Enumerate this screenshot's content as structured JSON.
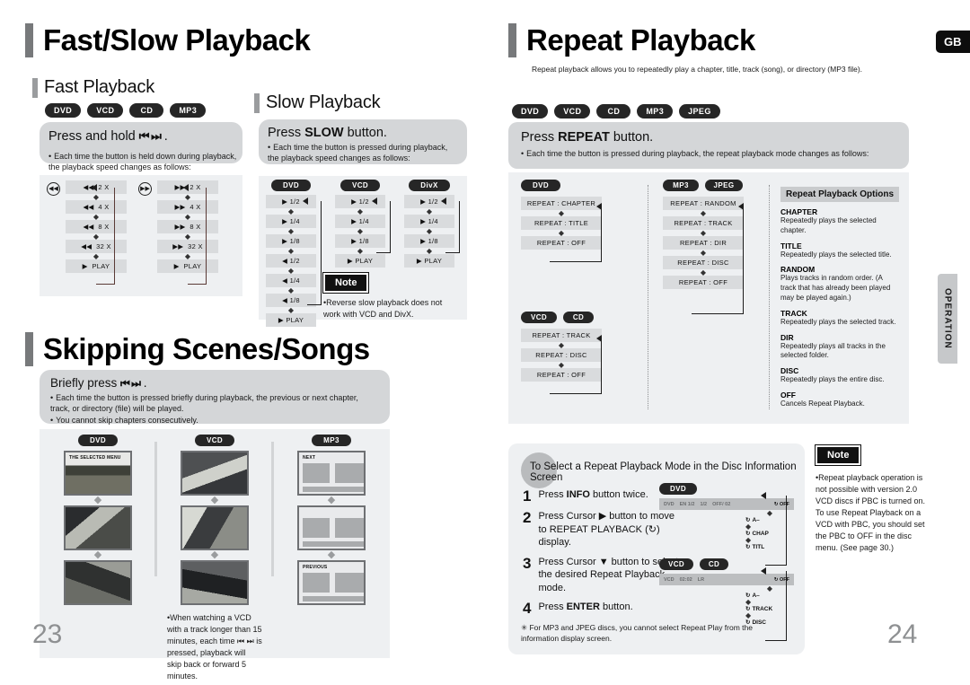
{
  "meta": {
    "language_badge": "GB",
    "side_tab": "OPERATION",
    "page_left": "23",
    "page_right": "24"
  },
  "left_page": {
    "title": "Fast/Slow Playback",
    "fast": {
      "heading": "Fast Playback",
      "chips": [
        "DVD",
        "VCD",
        "CD",
        "MP3"
      ],
      "instruction_pre": "Press and hold ",
      "instruction_icons": "⏮ ⏭",
      "instruction_post": " .",
      "bullet": "Each time the button is held down during playback, the playback speed changes as follows:",
      "reverse_steps": [
        "2 X",
        "4 X",
        "8 X",
        "32 X",
        "PLAY"
      ],
      "forward_steps": [
        "2 X",
        "4 X",
        "8 X",
        "32 X",
        "PLAY"
      ]
    },
    "slow": {
      "heading": "Slow Playback",
      "instruction_pre": "Press ",
      "instruction_bold": "SLOW",
      "instruction_post": " button.",
      "bullet": "Each time the button is pressed during playback, the playback speed changes as follows:",
      "columns": [
        {
          "chip": "DVD",
          "steps": [
            "1/2",
            "1/4",
            "1/8",
            "1/2",
            "1/4",
            "1/8",
            "PLAY"
          ],
          "reverse_from": 3
        },
        {
          "chip": "VCD",
          "steps": [
            "1/2",
            "1/4",
            "1/8",
            "PLAY"
          ],
          "reverse_from": 99
        },
        {
          "chip": "DivX",
          "steps": [
            "1/2",
            "1/4",
            "1/8",
            "PLAY"
          ],
          "reverse_from": 99
        }
      ],
      "note_label": "Note",
      "note_text": "Reverse slow playback does not work with VCD and DivX."
    },
    "skipping": {
      "title": "Skipping Scenes/Songs",
      "instruction_pre": "Briefly press ",
      "instruction_icons": "⏮ ⏭",
      "instruction_post": " .",
      "bullets": [
        "Each time the button is pressed briefly during playback, the previous or next chapter, track, or directory (file) will be played.",
        "You cannot skip chapters consecutively."
      ],
      "columns": [
        {
          "chip": "DVD",
          "captions": [
            "THE SELECTED MENU",
            "",
            ""
          ]
        },
        {
          "chip": "VCD",
          "captions": [
            "",
            "",
            ""
          ]
        },
        {
          "chip": "MP3",
          "captions": [
            "NEXT",
            "",
            "PREVIOUS"
          ]
        }
      ],
      "vcd_note": "When watching a VCD with a track longer than 15 minutes, each time ⏮ ⏭ is pressed, playback will skip back or forward 5 minutes."
    }
  },
  "right_page": {
    "title": "Repeat Playback",
    "subtitle": "Repeat playback allows you to repeatedly play a chapter, title, track (song), or directory (MP3 file).",
    "chips": [
      "DVD",
      "VCD",
      "CD",
      "MP3",
      "JPEG"
    ],
    "instruction_pre": "Press ",
    "instruction_bold": "REPEAT",
    "instruction_post": " button.",
    "bullet": "Each time the button is pressed during playback, the repeat playback mode changes as follows:",
    "flows": [
      {
        "chips": [
          "DVD"
        ],
        "steps": [
          "REPEAT : CHAPTER",
          "REPEAT : TITLE",
          "REPEAT : OFF"
        ]
      },
      {
        "chips": [
          "VCD",
          "CD"
        ],
        "steps": [
          "REPEAT : TRACK",
          "REPEAT : DISC",
          "REPEAT : OFF"
        ]
      },
      {
        "chips": [
          "MP3",
          "JPEG"
        ],
        "steps": [
          "REPEAT : RANDOM",
          "REPEAT : TRACK",
          "REPEAT : DIR",
          "REPEAT : DISC",
          "REPEAT : OFF"
        ]
      }
    ],
    "options": {
      "header": "Repeat Playback Options",
      "items": [
        {
          "term": "CHAPTER",
          "desc": "Repeatedly plays the selected chapter."
        },
        {
          "term": "TITLE",
          "desc": "Repeatedly plays the selected title."
        },
        {
          "term": "RANDOM",
          "desc": "Plays tracks in random order. (A track that has already been played may be played again.)"
        },
        {
          "term": "TRACK",
          "desc": "Repeatedly plays the selected track."
        },
        {
          "term": "DIR",
          "desc": "Repeatedly plays all tracks in the selected folder."
        },
        {
          "term": "DISC",
          "desc": "Repeatedly plays the entire disc."
        },
        {
          "term": "OFF",
          "desc": "Cancels Repeat Playback."
        }
      ]
    },
    "procedure": {
      "header": "To Select a Repeat Playback Mode in the Disc Information Screen",
      "steps": [
        {
          "num": "1",
          "pre": "Press ",
          "bold": "INFO",
          "post": " button twice."
        },
        {
          "num": "2",
          "pre": "Press Cursor ▶ button to move to REPEAT PLAYBACK (↻) display.",
          "bold": "",
          "post": ""
        },
        {
          "num": "3",
          "pre": "Press Cursor ▼ button to select the desired Repeat Playback mode.",
          "bold": "",
          "post": ""
        },
        {
          "num": "4",
          "pre": "Press ",
          "bold": "ENTER",
          "post": " button."
        }
      ],
      "footnote": "✳ For MP3 and JPEG discs, you cannot select Repeat Play from the information display screen.",
      "osd_dvd": {
        "chip": "DVD",
        "fields": [
          "DVD",
          "EN 1/2",
          "1/2",
          "OFF/ 02"
        ],
        "modes": [
          "OFF",
          "A–",
          "CHAP",
          "TITL"
        ]
      },
      "osd_vcd": {
        "chips": [
          "VCD",
          "CD"
        ],
        "fields": [
          "VCD",
          "02:02",
          "LR"
        ],
        "modes": [
          "OFF",
          "A–",
          "TRACK",
          "DISC"
        ]
      }
    },
    "note": {
      "label": "Note",
      "text": "Repeat playback operation is not possible with version 2.0 VCD discs if PBC is turned on. To use Repeat Playback on a VCD with PBC, you should set the PBC to OFF in the disc menu. (See page 30.)"
    }
  }
}
